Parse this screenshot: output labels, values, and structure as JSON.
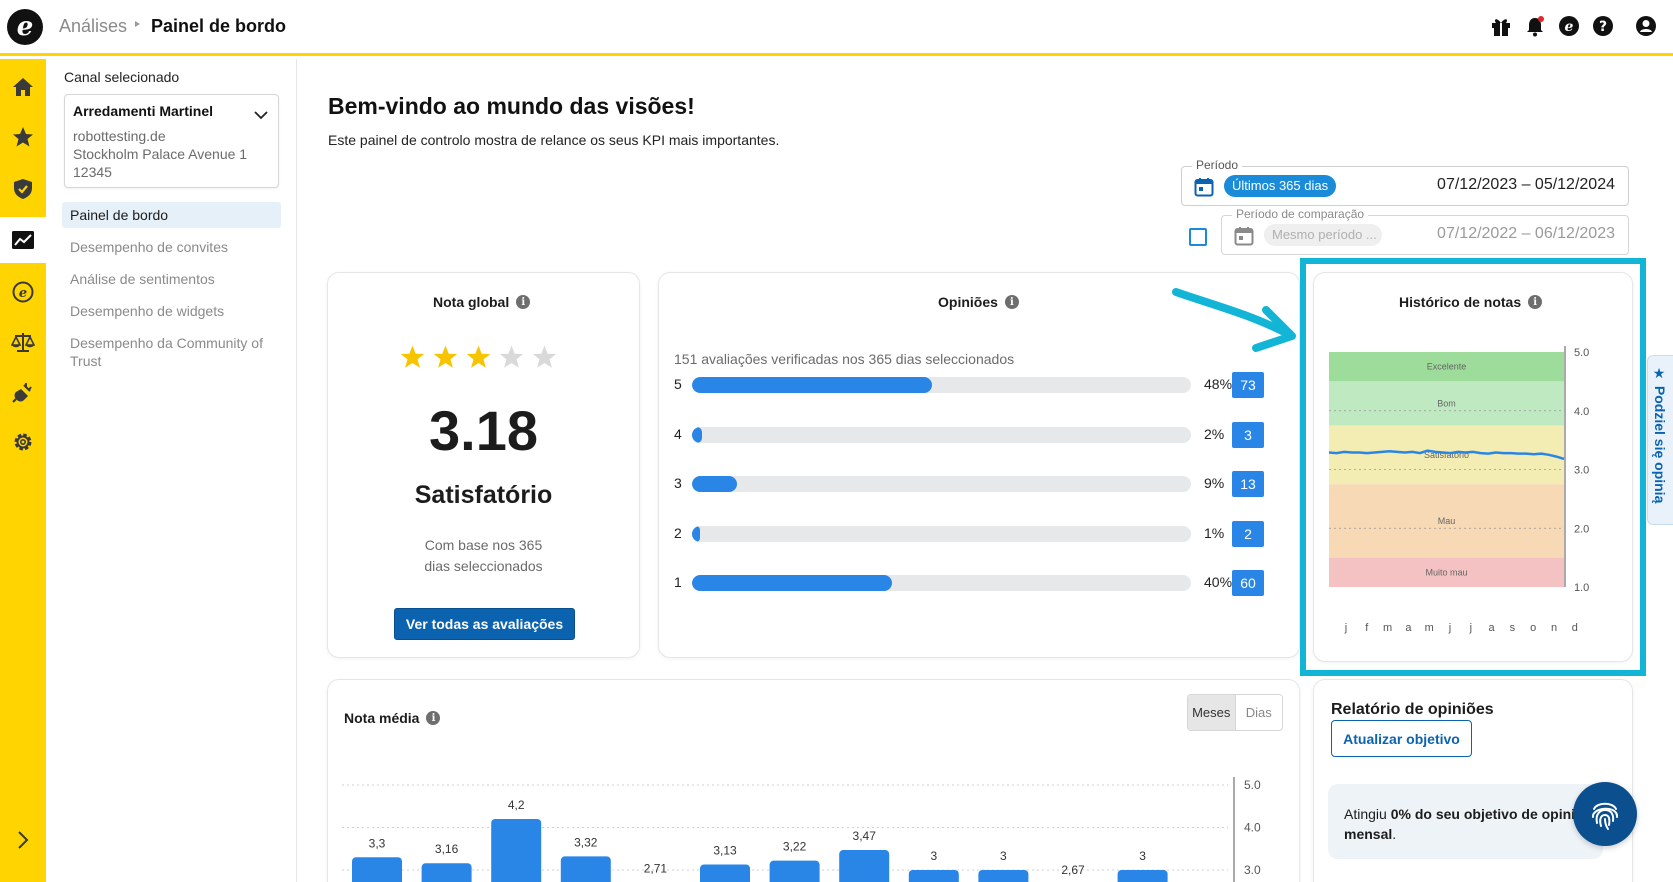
{
  "header": {
    "breadcrumb_parent": "Análises",
    "breadcrumb_current": "Painel de bordo",
    "icons": [
      "gift-icon",
      "bell-icon",
      "trustpilot-icon",
      "help-icon",
      "user-icon"
    ]
  },
  "rail": {
    "icons": [
      "home-icon",
      "star-icon",
      "shield-icon",
      "analytics-icon",
      "trustpilot-e-icon",
      "scale-icon",
      "plug-icon",
      "gear-icon"
    ],
    "active_index": 3
  },
  "sidebar": {
    "channel_label": "Canal selecionado",
    "channel": {
      "name": "Arredamenti Martinel",
      "domain": "robottesting.de",
      "address": "Stockholm Palace Avenue 1",
      "zip": "12345"
    },
    "items": [
      {
        "label": "Painel de bordo",
        "active": true
      },
      {
        "label": "Desempenho de convites",
        "active": false
      },
      {
        "label": "Análise de sentimentos",
        "active": false
      },
      {
        "label": "Desempenho de widgets",
        "active": false
      },
      {
        "label": "Desempenho da Community of Trust",
        "active": false
      }
    ]
  },
  "main": {
    "title": "Bem-vindo ao mundo das visões!",
    "subtitle": "Este painel de controlo mostra de relance os seus KPI mais importantes."
  },
  "period": {
    "legend": "Período",
    "chip": "Últimos 365 dias",
    "range": "07/12/2023 – 05/12/2024",
    "comparison_legend": "Período de comparação",
    "comparison_chip": "Mesmo período ...",
    "comparison_range": "07/12/2022 – 06/12/2023",
    "comparison_checked": false
  },
  "nota_global": {
    "title": "Nota global",
    "stars_filled": 3,
    "stars_total": 5,
    "score": "3.18",
    "score_word": "Satisfatório",
    "based_on_1": "Com base nos 365",
    "based_on_2": "dias seleccionados",
    "button": "Ver todas as avaliações"
  },
  "opinioes": {
    "title": "Opiniões",
    "subtitle": "151 avaliações verificadas nos 365 dias seleccionados",
    "rows": [
      {
        "star": "5",
        "percent": 48,
        "percent_label": "48%",
        "count": "73"
      },
      {
        "star": "4",
        "percent": 2,
        "percent_label": "2%",
        "count": "3"
      },
      {
        "star": "3",
        "percent": 9,
        "percent_label": "9%",
        "count": "13"
      },
      {
        "star": "2",
        "percent": 1,
        "percent_label": "1%",
        "count": "2"
      },
      {
        "star": "1",
        "percent": 40,
        "percent_label": "40%",
        "count": "60"
      }
    ]
  },
  "historico": {
    "title": "Histórico de notas",
    "bands": [
      {
        "label": "Excelente",
        "from": 4.5,
        "to": 5.0,
        "color": "#9ddc9a"
      },
      {
        "label": "Bom",
        "from": 3.75,
        "to": 4.5,
        "color": "#bfe9c0"
      },
      {
        "label": "Satisfatório",
        "from": 2.75,
        "to": 3.75,
        "color": "#f3ecb3"
      },
      {
        "label": "Mau",
        "from": 1.5,
        "to": 2.75,
        "color": "#f8d9b5"
      },
      {
        "label": "Muito mau",
        "from": 1.0,
        "to": 1.5,
        "color": "#f4c2c2"
      }
    ],
    "y_ticks": [
      "5.0",
      "4.0",
      "3.0",
      "2.0",
      "1.0"
    ],
    "ylim": [
      1,
      5
    ],
    "months": [
      "j",
      "f",
      "m",
      "a",
      "m",
      "j",
      "j",
      "a",
      "s",
      "o",
      "n",
      "d"
    ],
    "line": [
      3.29,
      3.28,
      3.3,
      3.29,
      3.29,
      3.28,
      3.29,
      3.3,
      3.31,
      3.3,
      3.29,
      3.3,
      3.28,
      3.32,
      3.3,
      3.29,
      3.28,
      3.3,
      3.29,
      3.3,
      3.28,
      3.27,
      3.29,
      3.28,
      3.28,
      3.27,
      3.27,
      3.26,
      3.27,
      3.25,
      3.22,
      3.18
    ],
    "line_color": "#2a86e6"
  },
  "nota_media": {
    "title": "Nota média",
    "toggle": [
      "Meses",
      "Dias"
    ],
    "active_toggle": "Meses"
  },
  "chart_data": {
    "type": "bar",
    "values": [
      3.3,
      3.16,
      4.2,
      3.32,
      2.71,
      3.13,
      3.22,
      3.47,
      3,
      3,
      2.67,
      3
    ],
    "value_labels": [
      "3,3",
      "3,16",
      "4,2",
      "3,32",
      "2,71",
      "3,13",
      "3,22",
      "3,47",
      "3",
      "3",
      "2,67",
      "3"
    ],
    "y_ticks": [
      "5.0",
      "4.0",
      "3.0"
    ],
    "color": "#2a86e6"
  },
  "relatorio": {
    "title": "Relatório de opiniões",
    "button": "Atualizar objetivo",
    "note_prefix": "Atingiu ",
    "note_bold": "0% do seu objetivo de opiniõ",
    "note_line2": "mensal",
    "note_suffix": "."
  },
  "feedback_tab": "★ Podziel się opinią"
}
